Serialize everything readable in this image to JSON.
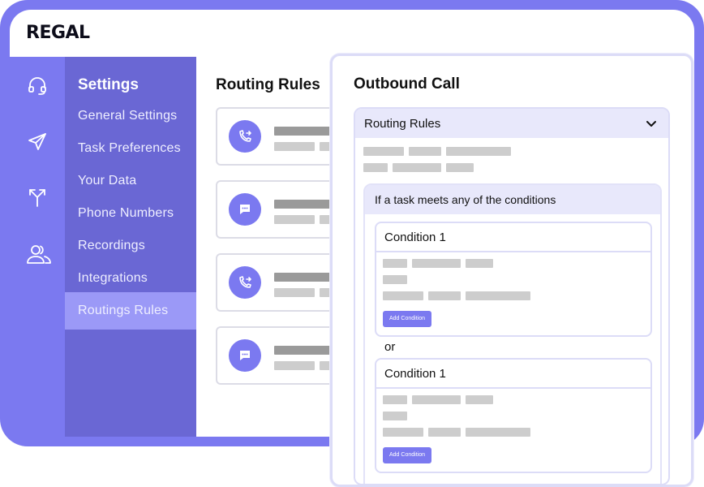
{
  "brand": {
    "logo": "REGAL",
    "accent": "#7b79f0",
    "sidebar_bg": "#6a67d4",
    "active_bg": "#9b99f7"
  },
  "rail": {
    "icons": [
      "headset-icon",
      "send-icon",
      "routing-split-icon",
      "users-icon"
    ]
  },
  "settings": {
    "title": "Settings",
    "items": [
      {
        "label": "General Settings",
        "active": false
      },
      {
        "label": "Task Preferences",
        "active": false
      },
      {
        "label": "Your Data",
        "active": false
      },
      {
        "label": "Phone Numbers",
        "active": false
      },
      {
        "label": "Recordings",
        "active": false
      },
      {
        "label": "Integrations",
        "active": false
      },
      {
        "label": "Routings Rules",
        "active": true
      }
    ]
  },
  "main": {
    "title": "Routing Rules",
    "rules": [
      {
        "icon": "call-forward-icon"
      },
      {
        "icon": "chat-bubble-icon"
      },
      {
        "icon": "call-forward-icon"
      },
      {
        "icon": "chat-bubble-icon"
      }
    ]
  },
  "panel": {
    "title": "Outbound Call",
    "accordion_label": "Routing Rules",
    "condition_group_label": "If a task meets any of the conditions",
    "conditions": [
      {
        "label": "Condition 1",
        "button": "Add Condition"
      },
      {
        "label": "Condition 1",
        "button": "Add Condition"
      }
    ],
    "or_label": "or"
  }
}
